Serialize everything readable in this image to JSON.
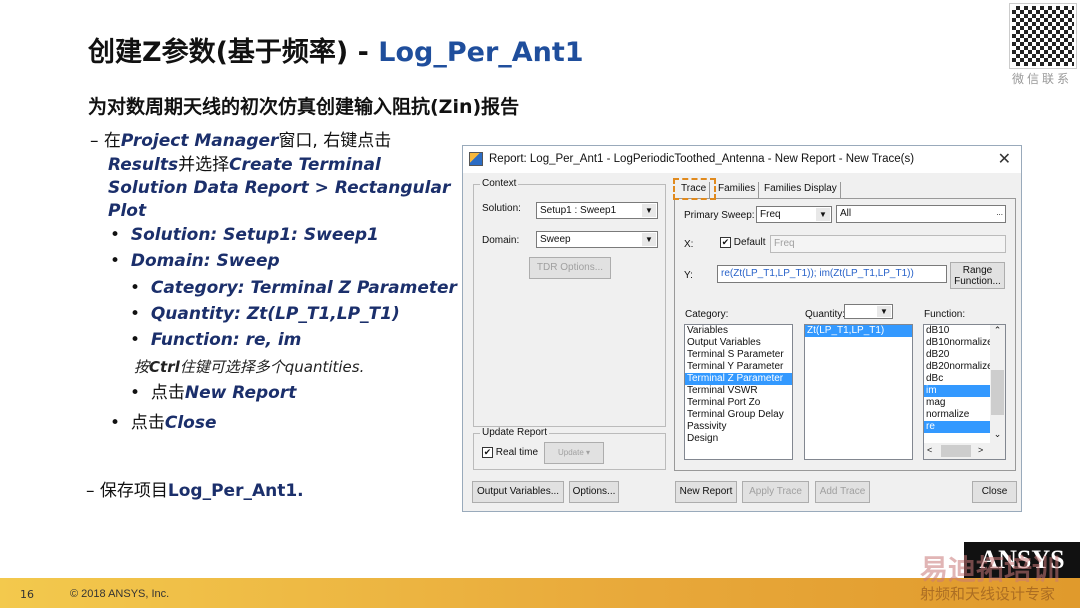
{
  "slide": {
    "title_main": "创建Z参数(基于频率) - ",
    "title_project": "Log_Per_Ant1",
    "subtitle": "为对数周期天线的初次仿真创建输入阻抗(Zin)报告",
    "qr_caption": "微信联系",
    "page_number": "16",
    "copyright": "© 2018 ANSYS, Inc.",
    "logo": "ANSYS",
    "watermark_1": "易迪拓培训",
    "watermark_2": "射频和天线设计专家"
  },
  "bullets": {
    "l1_a": "– 在",
    "l1_b": "Project Manager",
    "l1_c": "窗口, 右键点击",
    "l2_a": "Results",
    "l2_b": "并选择",
    "l2_c": "Create Terminal",
    "l3": "Solution Data Report > Rectangular",
    "l4": "Plot",
    "solution": "Solution: Setup1: Sweep1",
    "domain": "Domain: Sweep",
    "category": "Category: Terminal Z Parameter",
    "quantity": "Quantity: Zt(LP_T1,LP_T1)",
    "function": "Function: re, im",
    "note_a": "按",
    "note_b": "Ctrl",
    "note_c": "住键可选择多个quantities.",
    "newrep_a": "点击",
    "newrep_b": "New Report",
    "close_a": "点击",
    "close_b": "Close",
    "save_a": "– 保存项目",
    "save_b": "Log_Per_Ant1."
  },
  "dialog": {
    "title": "Report: Log_Per_Ant1 - LogPeriodicToothed_Antenna - New Report - New Trace(s)",
    "context_label": "Context",
    "solution_label": "Solution:",
    "solution_value": "Setup1 : Sweep1",
    "domain_label": "Domain:",
    "domain_value": "Sweep",
    "tdr_button": "TDR Options...",
    "update_group": "Update Report",
    "realtime_label": "Real time",
    "update_button": "Update",
    "output_vars_button": "Output Variables...",
    "options_button": "Options...",
    "tabs": [
      "Trace",
      "Families",
      "Families Display"
    ],
    "primary_sweep_label": "Primary Sweep:",
    "primary_sweep_value": "Freq",
    "sweep_range": "All",
    "ellipsis": "...",
    "x_label": "X:",
    "default_label": "Default",
    "x_value": "Freq",
    "y_label": "Y:",
    "y_value": "re(Zt(LP_T1,LP_T1)); im(Zt(LP_T1,LP_T1))",
    "range_function_button": "Range Function...",
    "category_label": "Category:",
    "categories": [
      "Variables",
      "Output Variables",
      "Terminal S Parameter",
      "Terminal Y Parameter",
      "Terminal Z Parameter",
      "Terminal VSWR",
      "Terminal Port Zo",
      "Terminal Group Delay",
      "Passivity",
      "Design"
    ],
    "selected_category": "Terminal Z Parameter",
    "quantity_label": "Quantity:",
    "quantities": [
      "Zt(LP_T1,LP_T1)"
    ],
    "function_label": "Function:",
    "functions": [
      "dB10",
      "dB10normalize",
      "dB20",
      "dB20normalize",
      "dBc",
      "im",
      "mag",
      "normalize",
      "re"
    ],
    "selected_functions": [
      "im",
      "re"
    ],
    "new_report_button": "New Report",
    "apply_trace_button": "Apply Trace",
    "add_trace_button": "Add Trace",
    "close_button": "Close",
    "realtime_checked": true,
    "default_checked": true,
    "highlight_color": "#3399ff",
    "callout_color": "#e08a1e"
  }
}
